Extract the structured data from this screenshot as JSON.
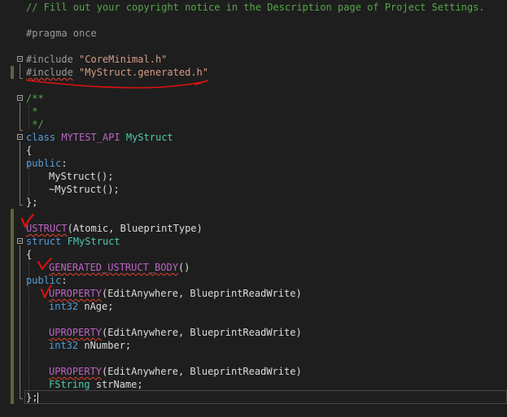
{
  "editor": {
    "lines": {
      "l1": {
        "comment": "// Fill out your copyright notice in the Description page of Project Settings."
      },
      "l3": {
        "preproc": "#pragma once"
      },
      "l5": {
        "directive": "#include",
        "path": "\"CoreMinimal.h\""
      },
      "l6": {
        "directive": "#include",
        "path": "\"MyStruct.generated.h\""
      },
      "l8": {
        "comment": "/**"
      },
      "l9": {
        "comment": " *"
      },
      "l10": {
        "comment": " */"
      },
      "l11": {
        "keyword": "class",
        "api": "MYTEST_API",
        "name": "MyStruct"
      },
      "l12": {
        "text": "{"
      },
      "l13": {
        "keyword": "public",
        "colon": ":"
      },
      "l14": {
        "text": "MyStruct();"
      },
      "l15": {
        "text": "~MyStruct();"
      },
      "l16": {
        "text": "};"
      },
      "l18": {
        "macro": "USTRUCT",
        "args": "(Atomic, BlueprintType)"
      },
      "l19": {
        "keyword": "struct",
        "name": "FMyStruct"
      },
      "l20": {
        "text": "{"
      },
      "l21": {
        "macro": "GENERATED_USTRUCT_BODY",
        "args": "()"
      },
      "l22": {
        "keyword": "public",
        "colon": ":"
      },
      "l23": {
        "macro": "UPROPERTY",
        "args": "(EditAnywhere, BlueprintReadWrite)"
      },
      "l24": {
        "type": "int32",
        "name": "nAge;"
      },
      "l26": {
        "macro": "UPROPERTY",
        "args": "(EditAnywhere, BlueprintReadWrite)"
      },
      "l27": {
        "type": "int32",
        "name": "nNumber;"
      },
      "l29": {
        "macro": "UPROPERTY",
        "args": "(EditAnywhere, BlueprintReadWrite)"
      },
      "l30": {
        "type": "FString",
        "name": "strName;"
      },
      "l31": {
        "text": "};"
      }
    }
  },
  "colors": {
    "background": "#1e1e1e",
    "comment": "#57a64a",
    "string": "#d69d85",
    "keyword": "#569cd6",
    "type": "#4ec9b0",
    "macro": "#bd63c5",
    "annotation": "#e01010",
    "change_bar": "#56683a"
  }
}
